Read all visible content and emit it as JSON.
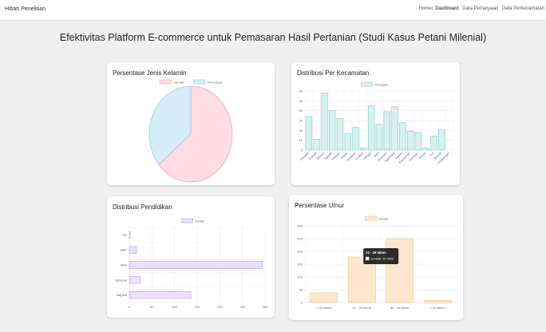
{
  "app": {
    "brand": "Hibah Penelitian",
    "nav": [
      "Home",
      "Dashboard",
      "Data Pertanyaan",
      "Data Perkecamatan"
    ]
  },
  "page_title": "Efektivitas Platform E-commerce untuk Pemasaran Hasil Pertanian (Studi Kasus Petani Milenial)",
  "colors": {
    "pink_fill": "#ffdde3",
    "pink_stroke": "#ff9fb2",
    "blue_fill": "#d6ecf9",
    "blue_stroke": "#9ccfea",
    "teal_fill": "#d6f0f0",
    "teal_stroke": "#7fcfcf",
    "purple_fill": "#ebe1ff",
    "purple_stroke": "#b799ff",
    "orange_fill": "#ffe7cf",
    "orange_stroke": "#ffb87a"
  },
  "chart_data": [
    {
      "id": "gender",
      "type": "pie",
      "title": "Persentase Jenis Kelamin",
      "legend": [
        "Laki-laki",
        "Perempuan"
      ],
      "values": [
        64,
        36
      ],
      "colors": [
        "pink",
        "blue"
      ]
    },
    {
      "id": "kecamatan",
      "type": "bar",
      "title": "Distribusi Per Kecamatan",
      "legend": [
        "Pekerjaan"
      ],
      "ylim": [
        0,
        60
      ],
      "yticks": [
        0,
        10,
        20,
        30,
        40,
        50,
        60
      ],
      "categories": [
        "Mangkal",
        "Monjali",
        "Sleman",
        "Ngaglik",
        "Kalasan",
        "Depok",
        "Gamping",
        "Godean",
        "Minggir",
        "Mlati",
        "Moyudan",
        "Ngemplak",
        "Pakem",
        "Prambanan",
        "Seyegan",
        "Tempel",
        "Turi",
        "Berbah",
        "Cangkringan"
      ],
      "values": [
        34,
        11,
        58,
        40,
        32,
        17,
        23,
        2,
        45,
        26,
        39,
        44,
        28,
        19,
        18,
        2,
        14,
        21,
        0
      ]
    },
    {
      "id": "pendidikan",
      "type": "bar",
      "orientation": "horizontal",
      "title": "Distribusi Pendidikan",
      "legend": [
        "Jumlah"
      ],
      "xlim": [
        0,
        300
      ],
      "xticks": [
        0,
        50,
        100,
        150,
        200,
        250,
        300
      ],
      "categories": [
        "SD",
        "SMP",
        "SMA",
        "Diploma",
        "Sarjana"
      ],
      "values": [
        2,
        16,
        294,
        24,
        136
      ]
    },
    {
      "id": "umur",
      "type": "bar",
      "title": "Persentase Umur",
      "legend": [
        "Jumlah"
      ],
      "ylim": [
        0,
        300
      ],
      "yticks": [
        0,
        50,
        100,
        150,
        200,
        250,
        300
      ],
      "categories": [
        "< 20 tahun",
        "21 - 29 tahun",
        "30 - 40 tahun",
        "> 40 tahun"
      ],
      "values": [
        38,
        178,
        250,
        8
      ],
      "tooltip": {
        "title": "21 - 29 tahun",
        "label": "Jumlah: 37.29%"
      }
    }
  ]
}
